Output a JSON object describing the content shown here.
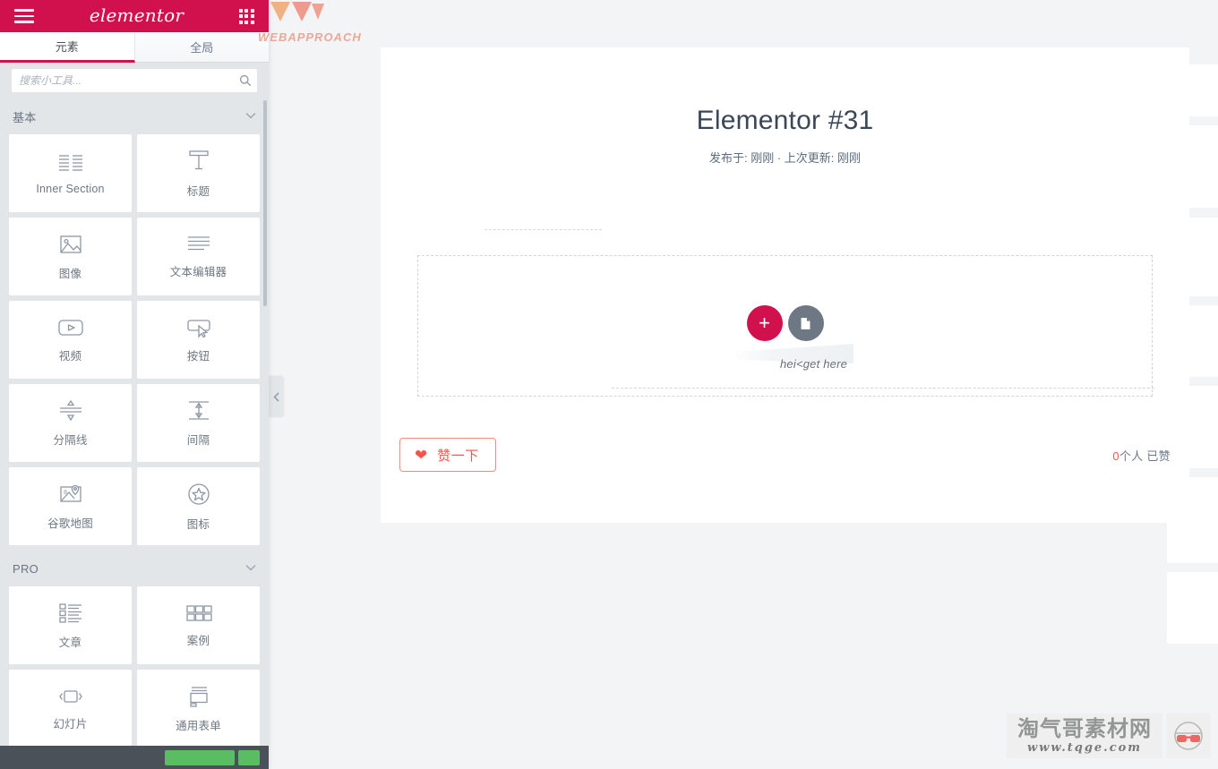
{
  "app": {
    "brand": "elementor",
    "accent": "#d0114d",
    "panel_bg": "#e2e6e9",
    "canvas_bg": "#f3f4f6"
  },
  "panel": {
    "menu_icon": "hamburger-icon",
    "apps_icon": "grid-apps-icon",
    "tabs": [
      {
        "label": "元素",
        "active": true
      },
      {
        "label": "全局",
        "active": false
      }
    ],
    "search": {
      "placeholder": "搜索小工具...",
      "value": "",
      "icon": "search-icon"
    },
    "categories": [
      {
        "title": "基本",
        "chevron": "chevron-down-icon",
        "widgets": [
          {
            "label": "Inner Section",
            "icon": "columns-icon"
          },
          {
            "label": "标题",
            "icon": "heading-t-icon"
          },
          {
            "label": "图像",
            "icon": "image-icon"
          },
          {
            "label": "文本编辑器",
            "icon": "text-lines-icon"
          },
          {
            "label": "视频",
            "icon": "video-play-icon"
          },
          {
            "label": "按钮",
            "icon": "button-cursor-icon"
          },
          {
            "label": "分隔线",
            "icon": "divider-icon"
          },
          {
            "label": "间隔",
            "icon": "spacer-icon"
          },
          {
            "label": "谷歌地图",
            "icon": "map-pin-icon"
          },
          {
            "label": "图标",
            "icon": "star-circle-icon"
          }
        ]
      },
      {
        "title": "PRO",
        "chevron": "chevron-down-icon",
        "widgets": [
          {
            "label": "文章",
            "icon": "posts-list-icon"
          },
          {
            "label": "案例",
            "icon": "portfolio-grid-icon"
          },
          {
            "label": "幻灯片",
            "icon": "slides-icon"
          },
          {
            "label": "通用表单",
            "icon": "form-icon"
          }
        ]
      }
    ],
    "footer": {
      "publish_button": "",
      "secondary_button": ""
    },
    "collapse_handle_icon": "chevron-left-icon"
  },
  "canvas": {
    "post_title": "Elementor #31",
    "post_meta": "发布于: 刚刚 · 上次更新: 刚刚",
    "dropzone": {
      "add_button_icon": "plus-icon",
      "add_button_label": "+",
      "template_button_icon": "folder-icon",
      "ghost_text": "hei<get here"
    },
    "like_bar": {
      "button_icon": "heart-icon",
      "button_label": "赞一下",
      "count_number": "0",
      "count_label": "个人 已赞"
    }
  },
  "watermarks": {
    "top_left_logo_name": "WEBAPPROACH",
    "bottom_right_cn": "淘气哥素材网",
    "bottom_right_url": "www.tqge.com",
    "bottom_right_icon": "glasses-icon"
  }
}
